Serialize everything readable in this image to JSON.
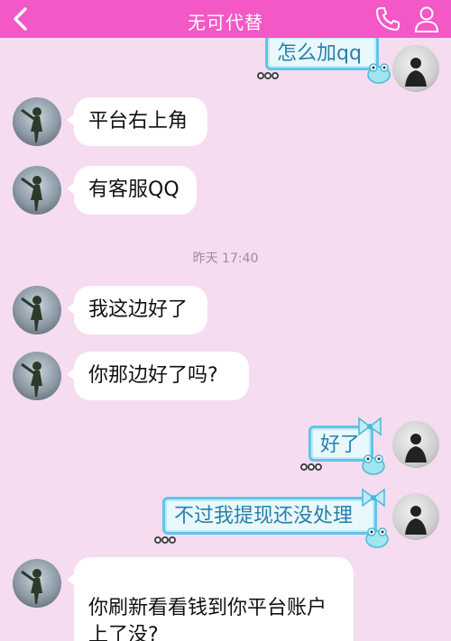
{
  "header": {
    "title": "无可代替",
    "back_icon": "back-chevron-icon",
    "call_icon": "phone-icon",
    "profile_icon": "person-icon",
    "bar_color": "#f457c6"
  },
  "messages": [
    {
      "side": "right",
      "text": "怎么加qq"
    },
    {
      "side": "left",
      "text": "平台右上角"
    },
    {
      "side": "left",
      "text": "有客服QQ"
    },
    {
      "side": "left",
      "text": "我这边好了"
    },
    {
      "side": "left",
      "text": "你那边好了吗?"
    },
    {
      "side": "right",
      "text": "好了"
    },
    {
      "side": "right",
      "text": "不过我提现还没处理"
    },
    {
      "side": "left",
      "text": "你刷新看看钱到你平台账户\n上了没?"
    }
  ],
  "timestamp": "昨天 17:40",
  "colors": {
    "chat_background": "#f6dcf0",
    "left_bubble": "#ffffff",
    "right_bubble_border": "#5fc6e8",
    "right_bubble_text": "#2a7fa8"
  }
}
